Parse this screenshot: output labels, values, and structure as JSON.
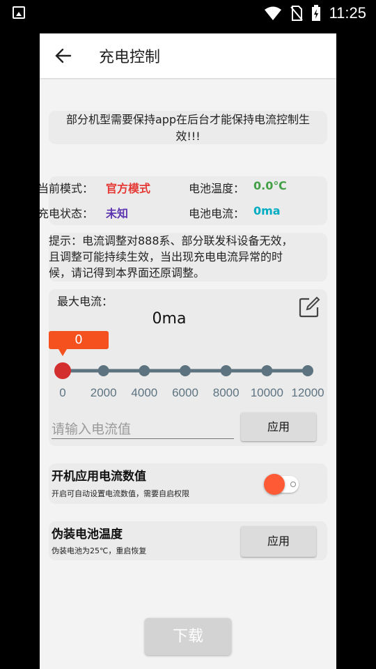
{
  "status_bar": {
    "time": "11:25",
    "icons": [
      "image-icon",
      "wifi-icon",
      "no-sim-icon",
      "battery-charging-icon"
    ]
  },
  "toolbar": {
    "back_icon": "arrow-back-icon",
    "title": "充电控制"
  },
  "notice": {
    "line1": "部分机型需要保持app在后台才能保持电流控制生",
    "line2": "效!!!"
  },
  "info": {
    "mode_label": "当前模式：",
    "mode_value": "官方模式",
    "temp_label": "电池温度：",
    "temp_value": "0.0℃",
    "charge_label": "充电状态：",
    "charge_value": "未知",
    "current_label": "电池电流：",
    "current_value": "0ma",
    "colors": {
      "mode_value": "#e53935",
      "temp_value": "#43a047",
      "charge_value": "#5e35b1",
      "current_value": "#00acc1"
    }
  },
  "tips": {
    "line1": "提示：电流调整对888系、部分联发科设备无效，",
    "line2": "且调整可能持续生效，当出现充电电流异常的时",
    "line3": "候，请记得到本界面还原调整。"
  },
  "max_current": {
    "label": "最大电流：",
    "value": "0ma",
    "edit_icon": "edit-icon",
    "slider_value": 0,
    "slider_min": 0,
    "slider_max": 12000,
    "bubble": "0",
    "ticks": [
      "0",
      "2000",
      "4000",
      "6000",
      "8000",
      "10000",
      "12000"
    ],
    "input_placeholder": "请输入电流值",
    "apply_label": "应用",
    "accent": "#f4511e"
  },
  "boot_apply": {
    "title": "开机应用电流数值",
    "desc": "开启可自动设置电流数值，需要自启权限",
    "toggle_on": false
  },
  "fake_temp": {
    "title": "伪装电池温度",
    "desc": "伪装电池为25℃，重启恢复",
    "apply_label": "应用"
  },
  "download_label": "下载"
}
